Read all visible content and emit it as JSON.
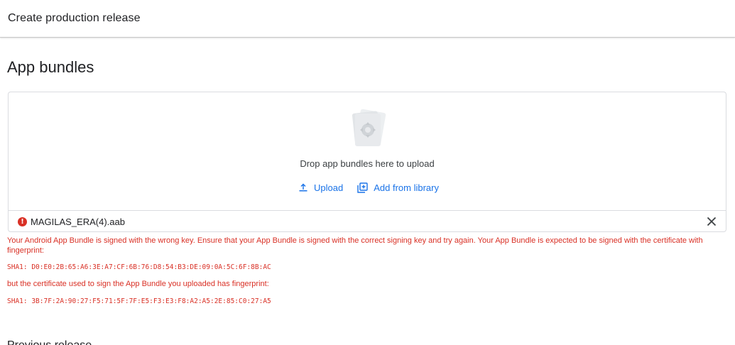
{
  "header": {
    "title": "Create production release"
  },
  "app_bundles": {
    "title": "App bundles",
    "drop_text": "Drop app bundles here to upload",
    "upload_label": "Upload",
    "add_from_library_label": "Add from library"
  },
  "file": {
    "name": "MAGILAS_ERA(4).aab",
    "status": "error"
  },
  "error": {
    "message": "Your Android App Bundle is signed with the wrong key. Ensure that your App Bundle is signed with the correct signing key and try again. Your App Bundle is expected to be signed with the certificate with fingerprint:",
    "expected_fingerprint": "SHA1: D0:E0:2B:65:A6:3E:A7:CF:6B:76:D8:54:B3:DE:09:0A:5C:6F:8B:AC",
    "uploaded_intro": "but the certificate used to sign the App Bundle you uploaded has fingerprint:",
    "uploaded_fingerprint": "SHA1: 3B:7F:2A:90:27:F5:71:5F:7F:E5:F3:E3:F8:A2:A5:2E:85:C0:27:A5"
  },
  "next_section": {
    "title": "Previous release"
  },
  "colors": {
    "accent": "#1a73e8",
    "error": "#d93025"
  }
}
